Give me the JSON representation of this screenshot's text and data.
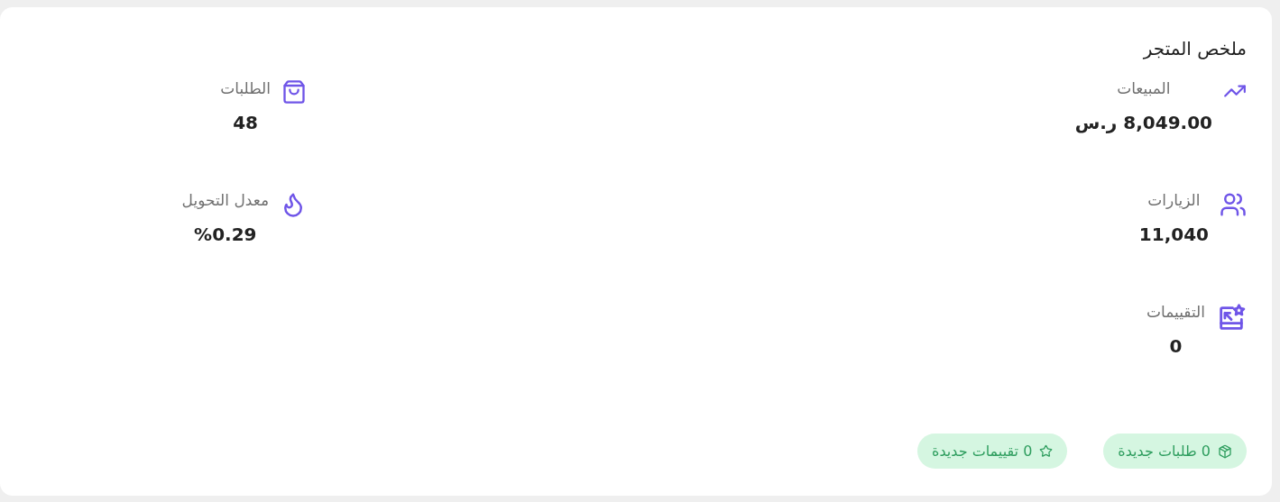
{
  "card": {
    "title": "ملخص المتجر",
    "stats": [
      {
        "label": "المبيعات",
        "value": "8,049.00 ر.س"
      },
      {
        "label": "الطلبات",
        "value": "48"
      },
      {
        "label": "الزيارات",
        "value": "11,040"
      },
      {
        "label": "معدل التحويل",
        "value": "%0.29"
      },
      {
        "label": "التقييمات",
        "value": "0"
      }
    ],
    "badges": [
      {
        "count": "0",
        "label": "طلبات جديدة"
      },
      {
        "count": "0",
        "label": "تقييمات جديدة"
      }
    ]
  }
}
